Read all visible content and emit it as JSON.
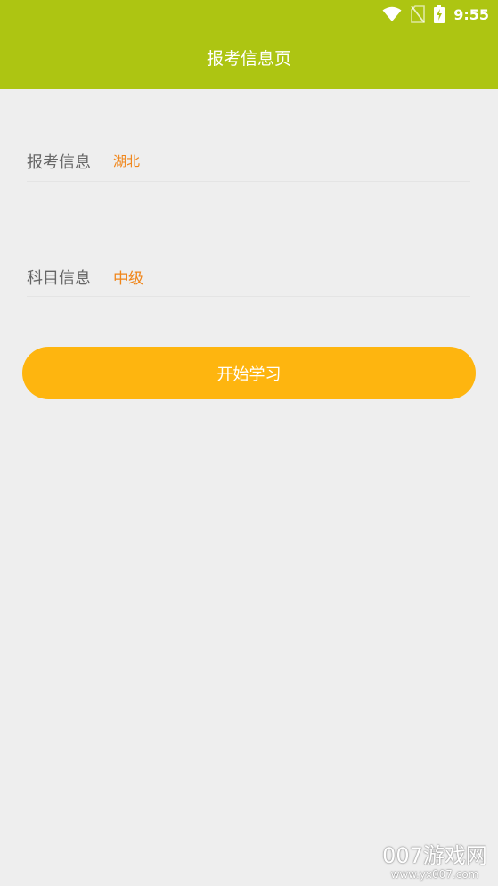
{
  "status_bar": {
    "time": "9:55",
    "icons": [
      "wifi-icon",
      "no-sim-icon",
      "battery-charging-icon"
    ]
  },
  "header": {
    "title": "报考信息页",
    "color": "#adc512"
  },
  "exam_info": {
    "label": "报考信息",
    "value": "湖北"
  },
  "subject_info": {
    "label": "科目信息",
    "value": "中级"
  },
  "start_button": {
    "label": "开始学习",
    "color": "#feb50f"
  },
  "accent_color": "#f08519",
  "watermark": {
    "name": "007游戏网",
    "url": "www.yx007.com"
  }
}
